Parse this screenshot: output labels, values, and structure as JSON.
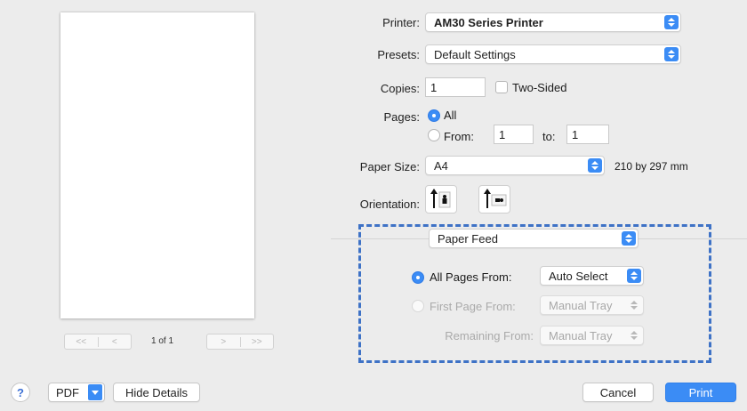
{
  "preview": {
    "page_indicator": "1 of 1",
    "first_label": "<<",
    "prev_label": "<",
    "next_label": ">",
    "last_label": ">>"
  },
  "printer": {
    "label": "Printer:",
    "value": "AM30 Series Printer"
  },
  "presets": {
    "label": "Presets:",
    "value": "Default Settings"
  },
  "copies": {
    "label": "Copies:",
    "value": "1",
    "two_sided_label": "Two-Sided",
    "two_sided_checked": false
  },
  "pages": {
    "label": "Pages:",
    "all_label": "All",
    "from_label": "From:",
    "from_value": "1",
    "to_label": "to:",
    "to_value": "1",
    "selected": "All"
  },
  "paper_size": {
    "label": "Paper Size:",
    "value": "A4",
    "dimensions": "210 by 297 mm"
  },
  "orientation": {
    "label": "Orientation:",
    "options": [
      "portrait-icon",
      "landscape-icon"
    ],
    "selected": "portrait"
  },
  "section": {
    "value": "Paper Feed"
  },
  "paper_feed": {
    "all_pages_label": "All Pages From:",
    "all_pages_value": "Auto Select",
    "first_page_label": "First Page From:",
    "first_page_value": "Manual Tray",
    "remaining_label": "Remaining From:",
    "remaining_value": "Manual Tray",
    "selected": "All Pages From"
  },
  "footer": {
    "help_label": "?",
    "pdf_label": "PDF",
    "hide_details_label": "Hide Details",
    "cancel_label": "Cancel",
    "print_label": "Print"
  },
  "colors": {
    "accent": "#3b8cf5",
    "highlight_box": "#3e72c6"
  }
}
